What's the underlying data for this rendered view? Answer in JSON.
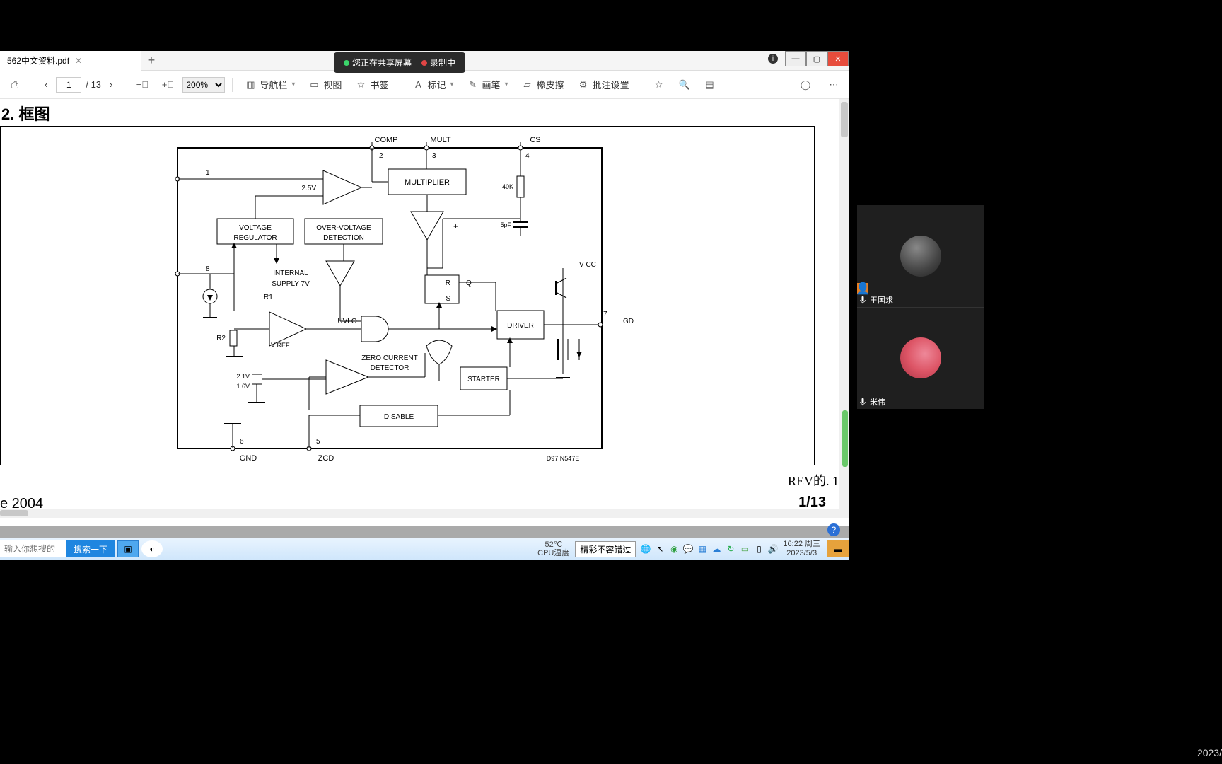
{
  "tab": {
    "title": "562中文资料.pdf"
  },
  "share": {
    "sharing": "您正在共享屏幕",
    "recording": "录制中"
  },
  "toolbar": {
    "page_current": "1",
    "page_total": "/ 13",
    "zoom": "200%",
    "nav": "导航栏",
    "view": "视图",
    "bookmark": "书签",
    "mark": "标记",
    "pen": "画笔",
    "eraser": "橡皮擦",
    "annotate": "批注设置"
  },
  "doc": {
    "heading": "2. 框图",
    "rev": "REV的.  1",
    "page_count": "1/13",
    "year": "e 2004"
  },
  "diagram": {
    "pins": {
      "comp": "COMP",
      "mult": "MULT",
      "cs": "CS",
      "gnd": "GND",
      "zcd": "ZCD",
      "gd": "GD",
      "vcc": "V CC"
    },
    "pin_nums": {
      "p1": "1",
      "p2": "2",
      "p3": "3",
      "p4": "4",
      "p5": "5",
      "p6": "6",
      "p7": "7",
      "p8": "8"
    },
    "blocks": {
      "multiplier": "MULTIPLIER",
      "volt_reg1": "VOLTAGE",
      "volt_reg2": "REGULATOR",
      "ovd1": "OVER-VOLTAGE",
      "ovd2": "DETECTION",
      "internal1": "INTERNAL",
      "internal2": "SUPPLY 7V",
      "uvlo": "UVLO",
      "driver": "DRIVER",
      "zero1": "ZERO CURRENT",
      "zero2": "DETECTOR",
      "starter": "STARTER",
      "disable": "DISABLE",
      "rs_r": "R",
      "rs_s": "S",
      "rs_q": "Q"
    },
    "labels": {
      "v25": "2.5V",
      "r1": "R1",
      "r2": "R2",
      "vref": "V REF",
      "v21": "2.1V",
      "v16": "1.6V",
      "k40": "40K",
      "pf5": "5pF",
      "partno": "D97IN547E"
    }
  },
  "taskbar": {
    "search_placeholder": "输入你想搜的",
    "search_btn": "搜索一下",
    "cpu_value": "52℃",
    "cpu_label": "CPU温度",
    "banner": "精彩不容错过",
    "time": "16:22 周三",
    "date": "2023/5/3"
  },
  "video": {
    "p1_name": "王国求",
    "p2_name": "米伟"
  },
  "global_time": "2023/"
}
